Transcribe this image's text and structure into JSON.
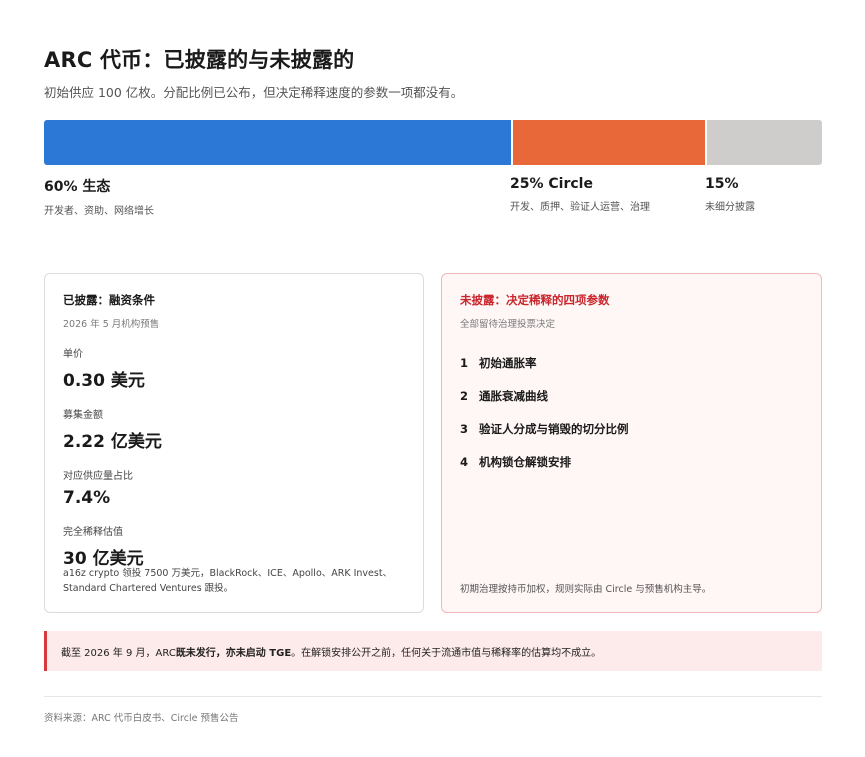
{
  "header": {
    "title": "ARC 代币：已披露的与未披露的",
    "subtitle": "初始供应 100 亿枚。分配比例已公布，但决定稀释速度的参数一项都没有。"
  },
  "allocation": {
    "segments": [
      {
        "pct_label": "60% 生态",
        "desc": "开发者、资助、网络增长",
        "share": 60,
        "color": "#2b78d6"
      },
      {
        "pct_label": "25% Circle",
        "desc": "开发、质押、验证人运营、治理",
        "share": 25,
        "color": "#e8683a"
      },
      {
        "pct_label": "15%",
        "desc": "未细分披露",
        "share": 15,
        "color": "#cfcdcb"
      }
    ]
  },
  "disclosed": {
    "title": "已披露：融资条件",
    "subtitle": "2026 年 5 月机构预售",
    "metrics": [
      {
        "label": "单价",
        "value": "0.30 美元"
      },
      {
        "label": "募集金额",
        "value": "2.22 亿美元"
      },
      {
        "label": "对应供应量占比",
        "value": "7.4%"
      },
      {
        "label": "完全稀释估值",
        "value": "30 亿美元"
      }
    ],
    "investors_line1": "a16z crypto 领投 7500 万美元，BlackRock、ICE、Apollo、ARK Invest、",
    "investors_line2": "Standard Chartered Ventures 跟投。"
  },
  "undisclosed": {
    "title": "未披露：决定稀释的四项参数",
    "subtitle": "全部留待治理投票决定",
    "params": [
      {
        "num": "1",
        "label": "初始通胀率"
      },
      {
        "num": "2",
        "label": "通胀衰减曲线"
      },
      {
        "num": "3",
        "label": "验证人分成与销毁的切分比例"
      },
      {
        "num": "4",
        "label": "机构锁仓解锁安排"
      }
    ],
    "note": "初期治理按持币加权，规则实际由 Circle 与预售机构主导。"
  },
  "callout": {
    "prefix": "截至 2026 年 9 月，ARC ",
    "bold": "既未发行，亦未启动 TGE",
    "suffix": "。在解锁安排公开之前，任何关于流通市值与稀释率的估算均不成立。"
  },
  "footer": {
    "source": "资料来源：ARC 代币白皮书、Circle 预售公告"
  }
}
